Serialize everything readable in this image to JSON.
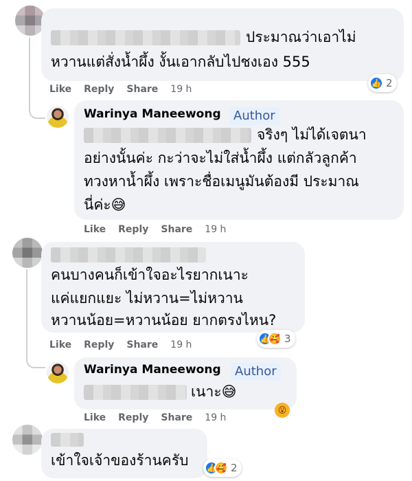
{
  "comments": [
    {
      "text_lines": [
        "ประมาณว่าเอาไม่",
        "หวานแต่สั่งน้ำผึ้ง งั้นเอากลับไปชงเอง 555"
      ],
      "actions": {
        "like": "Like",
        "reply": "Reply",
        "share": "Share",
        "time": "19 h"
      },
      "reaction_count": "2",
      "reaction_icons": [
        "like-icon"
      ]
    },
    {
      "author": "Warinya Maneewong",
      "badge": "Author",
      "text_lines": [
        "จริงๆ ไม่ได้เจตนา",
        "อย่างนั้นค่ะ กะว่าจะไม่ใส่น้ำผึ้ง แต่กลัวลูกค้า",
        "ทวงหาน้ำผึ้ง เพราะชื่อเมนูมันต้องมี ประมาณ",
        "นี่ค่ะ😅"
      ],
      "actions": {
        "like": "Like",
        "reply": "Reply",
        "share": "Share",
        "time": "19 h"
      }
    },
    {
      "text_lines": [
        "คนบางคนก็เข้าใจอะไรยากเนาะ",
        "แค่แยกแยะ ไม่หวาน=ไม่หวาน",
        "หวานน้อย=หวานน้อย ยากตรงไหน?"
      ],
      "actions": {
        "like": "Like",
        "reply": "Reply",
        "share": "Share",
        "time": "19 h"
      },
      "reaction_count": "3",
      "reaction_icons": [
        "like-icon",
        "care-icon"
      ]
    },
    {
      "author": "Warinya Maneewong",
      "badge": "Author",
      "text_lines": [
        "เนาะ😅"
      ],
      "actions": {
        "like": "Like",
        "reply": "Reply",
        "share": "Share",
        "time": "19 h"
      },
      "reaction_icons": [
        "wow-icon"
      ]
    },
    {
      "text_lines": [
        "เข้าใจเจ้าของร้านครับ"
      ],
      "reaction_count": "2",
      "reaction_icons": [
        "like-icon",
        "care-icon"
      ]
    }
  ]
}
